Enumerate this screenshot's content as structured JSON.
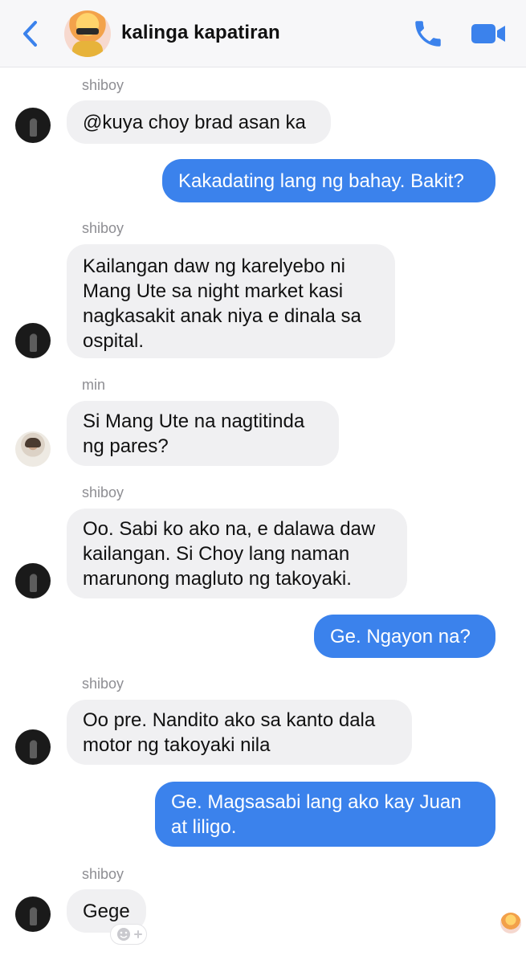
{
  "header": {
    "title": "kalinga kapatiran",
    "back_icon": "chevron-left-icon",
    "call_icon": "phone-icon",
    "video_icon": "video-camera-icon",
    "accent_color": "#3b82ec"
  },
  "messages": [
    {
      "sender": "shiboy",
      "text": "@kuya choy brad asan ka"
    },
    {
      "sender": "me",
      "text": "Kakadating lang ng bahay. Bakit?"
    },
    {
      "sender": "shiboy",
      "text": "Kailangan daw ng karelyebo ni\nMang Ute sa night market kasi\nnagkasakit anak niya e dinala sa\nospital."
    },
    {
      "sender": "min",
      "text": "Si Mang Ute na nagtitinda\nng pares?"
    },
    {
      "sender": "shiboy",
      "text": "Oo. Sabi ko ako na, e dalawa daw\nkailangan. Si Choy lang naman\nmarunong magluto ng takoyaki."
    },
    {
      "sender": "me",
      "text": "Ge. Ngayon na?"
    },
    {
      "sender": "shiboy",
      "text": "Oo pre. Nandito ako sa kanto dala\nmotor ng takoyaki nila"
    },
    {
      "sender": "me",
      "text": "Ge. Magsasabi lang ako kay Juan\nat liligo."
    },
    {
      "sender": "shiboy",
      "text": "Gege"
    }
  ],
  "icons": {
    "add_reaction": "add-reaction-icon",
    "seen": "seen-avatar-icon"
  }
}
